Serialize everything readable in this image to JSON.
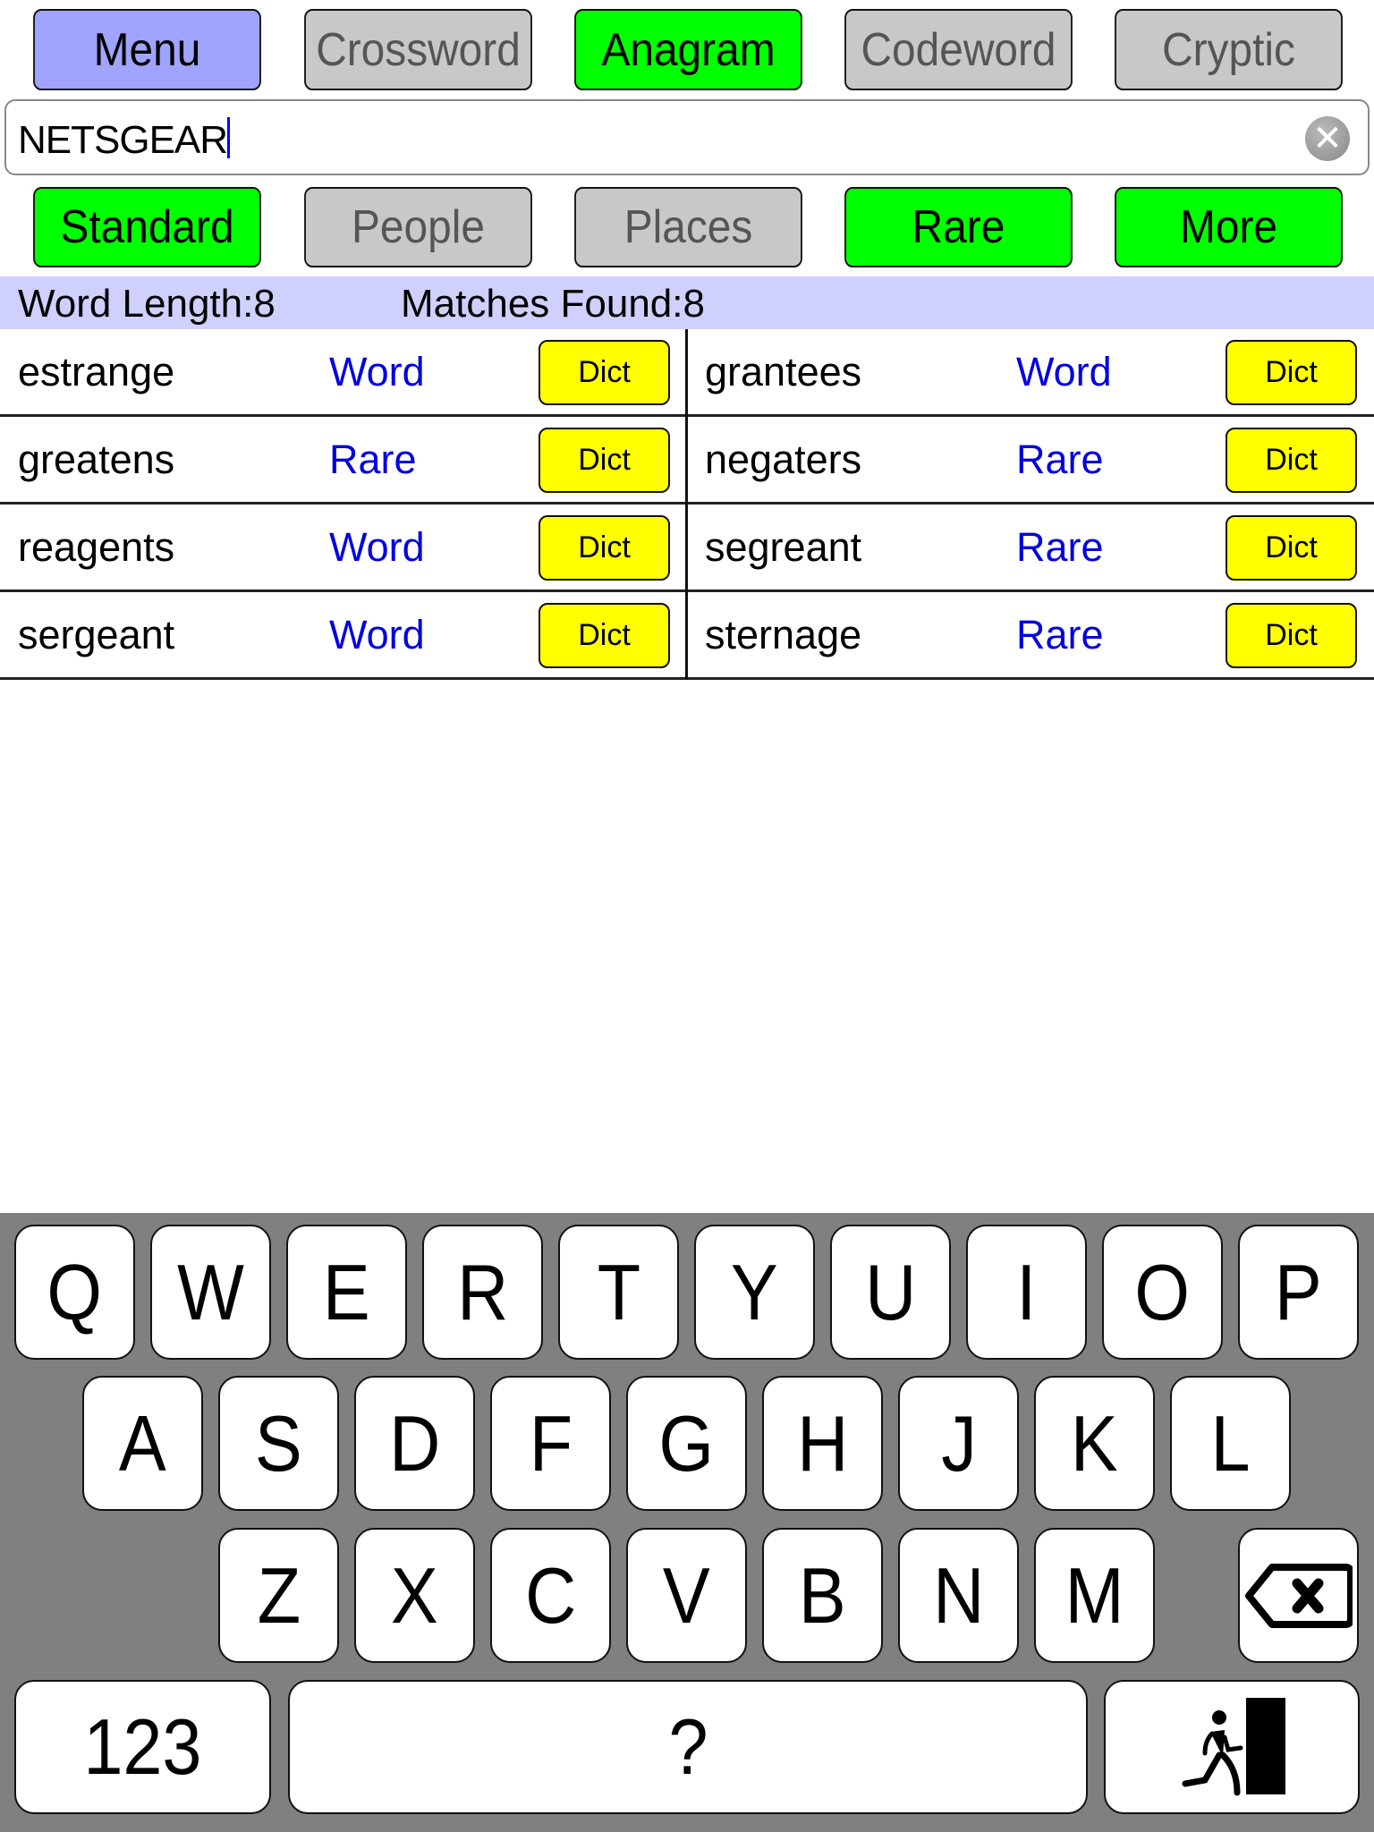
{
  "mode_tabs": [
    {
      "label": "Menu",
      "state": "menu"
    },
    {
      "label": "Crossword",
      "state": "inactive"
    },
    {
      "label": "Anagram",
      "state": "active"
    },
    {
      "label": "Codeword",
      "state": "inactive"
    },
    {
      "label": "Cryptic",
      "state": "inactive"
    }
  ],
  "search": {
    "value": "NETSGEAR",
    "clear_icon": "clear-circle-icon"
  },
  "filters": [
    {
      "label": "Standard",
      "state": "active"
    },
    {
      "label": "People",
      "state": "inactive"
    },
    {
      "label": "Places",
      "state": "inactive"
    },
    {
      "label": "Rare",
      "state": "active"
    },
    {
      "label": "More",
      "state": "active"
    }
  ],
  "info": {
    "word_length": "Word Length:8",
    "matches_found": "Matches Found:8"
  },
  "results": [
    {
      "left": {
        "word": "estrange",
        "type": "Word",
        "dict": "Dict"
      },
      "right": {
        "word": "grantees",
        "type": "Word",
        "dict": "Dict"
      }
    },
    {
      "left": {
        "word": "greatens",
        "type": "Rare",
        "dict": "Dict"
      },
      "right": {
        "word": "negaters",
        "type": "Rare",
        "dict": "Dict"
      }
    },
    {
      "left": {
        "word": "reagents",
        "type": "Word",
        "dict": "Dict"
      },
      "right": {
        "word": "segreant",
        "type": "Rare",
        "dict": "Dict"
      }
    },
    {
      "left": {
        "word": "sergeant",
        "type": "Word",
        "dict": "Dict"
      },
      "right": {
        "word": "sternage",
        "type": "Rare",
        "dict": "Dict"
      }
    }
  ],
  "keyboard": {
    "row1": [
      "Q",
      "W",
      "E",
      "R",
      "T",
      "Y",
      "U",
      "I",
      "O",
      "P"
    ],
    "row2": [
      "A",
      "S",
      "D",
      "F",
      "G",
      "H",
      "J",
      "K",
      "L"
    ],
    "row3": [
      "Z",
      "X",
      "C",
      "V",
      "B",
      "N",
      "M"
    ],
    "backspace_icon": "backspace-icon",
    "numbers_label": "123",
    "wildcard_label": "?",
    "exit_icon": "exit-door-icon"
  },
  "colors": {
    "menu": "#a0a4ff",
    "active": "#00ff00",
    "inactive": "#c8c8c8",
    "dict": "#ffff00",
    "info_bar": "#d0d0ff",
    "link_blue": "#0000e0",
    "keyboard_bg": "#808080"
  }
}
